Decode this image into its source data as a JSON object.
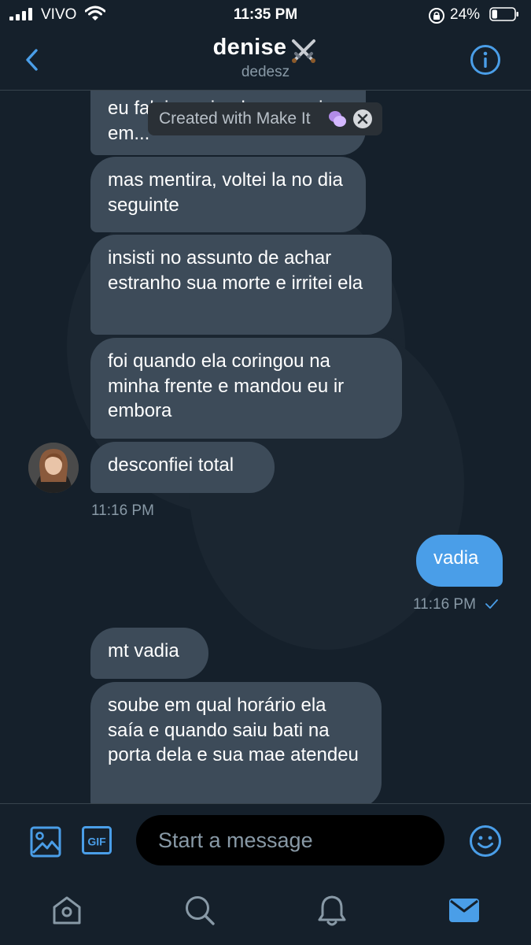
{
  "status_bar": {
    "carrier": "VIVO",
    "time": "11:35 PM",
    "battery_percent": "24%",
    "battery_level": 0.24,
    "icons": [
      "signal-icon",
      "wifi-icon",
      "orientation-lock-icon",
      "battery-icon"
    ]
  },
  "header": {
    "title": "denise",
    "title_emoji": "crossed-swords-icon",
    "subtitle": "dedesz",
    "back_icon": "chevron-left-icon",
    "info_icon": "info-icon"
  },
  "overlay": {
    "text": "Created with Make It",
    "icons": [
      "speech-bubbles-icon",
      "close-icon"
    ]
  },
  "messages": [
    {
      "side": "left",
      "text": "eu falei que ia almoçar e ir em..."
    },
    {
      "side": "left",
      "text": "mas mentira, voltei la no dia seguinte"
    },
    {
      "side": "left",
      "text": "insisti no assunto de achar estranho sua morte e irritei ela"
    },
    {
      "side": "left",
      "text": "foi quando ela coringou na minha frente e mandou eu ir embora"
    },
    {
      "side": "left",
      "text": "desconfiei total"
    },
    {
      "side": "left_time",
      "text": "11:16 PM"
    },
    {
      "side": "right",
      "text": "vadia"
    },
    {
      "side": "right_time",
      "text": "11:16 PM"
    },
    {
      "side": "left",
      "text": "mt vadia"
    },
    {
      "side": "left",
      "text": "soube em qual horário ela saía e quando saiu bati na porta dela e sua mae atendeu"
    }
  ],
  "composer": {
    "placeholder": "Start a message",
    "gif_label": "GIF",
    "icons": [
      "image-icon",
      "gif-icon",
      "emoji-icon"
    ]
  },
  "tabbar": {
    "tabs": [
      "home-icon",
      "search-icon",
      "notifications-icon",
      "messages-icon"
    ],
    "active_tab": "messages-icon"
  },
  "colors": {
    "background": "#15202b",
    "bubble_received": "#3d4b59",
    "bubble_sent": "#4a9ee8",
    "accent": "#4a9ee8",
    "muted_text": "#8899a6"
  }
}
